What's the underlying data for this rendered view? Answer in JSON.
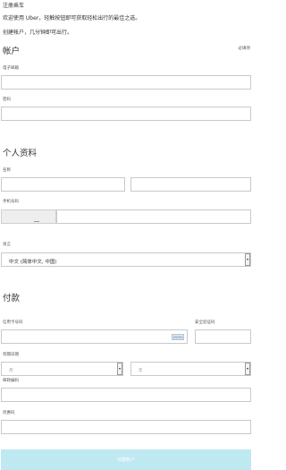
{
  "header": {
    "title": "注册乘车",
    "welcome": "欢迎使用 Uber，轻触按钮即可获取轻松出行的最佳之选。",
    "create": "创建帐户，几分钟即可出行。"
  },
  "account": {
    "section_title": "帐户",
    "required_note": "必填项",
    "email_label": "电子邮箱",
    "password_label": "密码"
  },
  "profile": {
    "section_title": "个人资料",
    "name_label": "名称",
    "phone_label": "手机号码",
    "language_label": "语言",
    "language_value": "中文 (简体中文, 中国)"
  },
  "payment": {
    "section_title": "付款",
    "card_label": "信用卡号码",
    "cvv_label": "安全验证码",
    "expiry_label": "到期日期",
    "month_placeholder": "月",
    "year_placeholder": "年",
    "postal_label": "邮政编码",
    "promo_label": "优惠码"
  },
  "actions": {
    "submit_label": "创建帐户"
  },
  "colors": {
    "submit_bg": "#bfe9f1",
    "field_border": "#c9c9c9"
  }
}
